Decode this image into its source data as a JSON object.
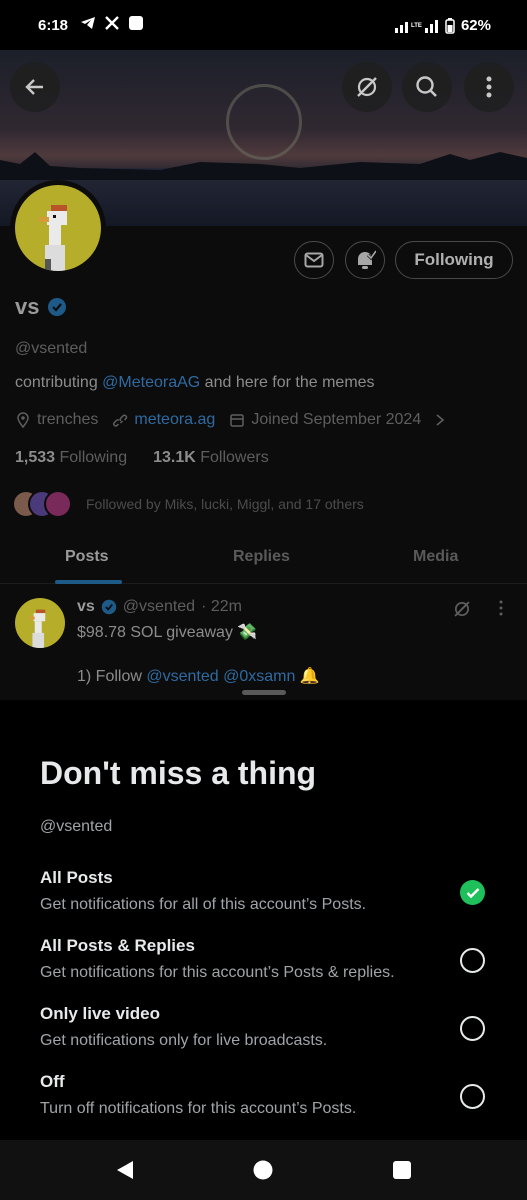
{
  "status_bar": {
    "time": "6:18",
    "battery": "62%",
    "icons": [
      "telegram-icon",
      "x-icon",
      "square-app-icon",
      "wifi-icon",
      "lte-icon",
      "signal-icon",
      "battery-icon"
    ]
  },
  "profile": {
    "name": "vs",
    "handle": "@vsented",
    "bio_prefix": "contributing ",
    "bio_link": "@MeteoraAG",
    "bio_suffix": " and here for the memes",
    "location": "trenches",
    "website": "meteora.ag",
    "joined": "Joined September 2024",
    "following_count": "1,533",
    "following_label": "Following",
    "followers_count": "13.1K",
    "followers_label": "Followers",
    "followed_by": "Followed by Miks, lucki, Miggl, and 17 others",
    "following_button": "Following"
  },
  "tabs": [
    "Posts",
    "Replies",
    "Media"
  ],
  "post": {
    "name": "vs",
    "handle": "@vsented",
    "time": "· 22m",
    "line1": "$98.78 SOL giveaway 💸",
    "line2_prefix": "1) Follow ",
    "mention1": "@vsented",
    "mention2": "@0xsamn",
    "line2_suffix": " 🔔"
  },
  "sheet": {
    "title": "Don't miss a thing",
    "handle": "@vsented",
    "options": [
      {
        "title": "All Posts",
        "desc": "Get notifications for all of this account’s Posts.",
        "selected": true
      },
      {
        "title": "All Posts & Replies",
        "desc": "Get notifications for this account’s Posts & replies.",
        "selected": false
      },
      {
        "title": "Only live video",
        "desc": "Get notifications only for live broadcasts.",
        "selected": false
      },
      {
        "title": "Off",
        "desc": "Turn off notifications for this account’s Posts.",
        "selected": false
      }
    ]
  },
  "colors": {
    "accent_blue": "#1d9bf0",
    "selected_green": "#1fbf5b",
    "background": "#000000"
  }
}
